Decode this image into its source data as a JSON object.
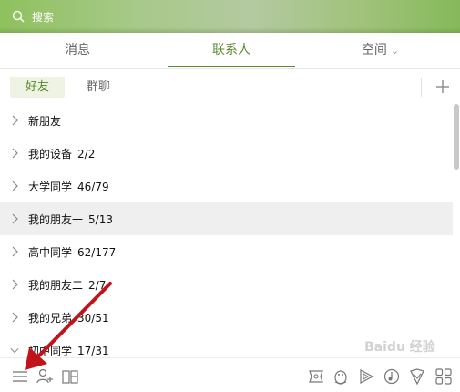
{
  "search": {
    "placeholder": "搜索"
  },
  "tabs": [
    {
      "label": "消息"
    },
    {
      "label": "联系人",
      "active": true
    },
    {
      "label": "空间"
    }
  ],
  "subtabs": [
    {
      "label": "好友",
      "active": true
    },
    {
      "label": "群聊"
    }
  ],
  "groups": [
    {
      "name": "新朋友",
      "count": ""
    },
    {
      "name": "我的设备",
      "count": "2/2"
    },
    {
      "name": "大学同学",
      "count": "46/79"
    },
    {
      "name": "我的朋友一",
      "count": "5/13",
      "hover": true
    },
    {
      "name": "高中同学",
      "count": "62/177"
    },
    {
      "name": "我的朋友二",
      "count": "2/7"
    },
    {
      "name": "我的兄弟",
      "count": "30/51"
    },
    {
      "name": "初中同学",
      "count": "17/31",
      "expanded": true
    }
  ],
  "watermark": "Baidu 经验",
  "colors": {
    "accent": "#5a8a2e",
    "header_green": "#9fc279",
    "annotation_red": "#c0141a"
  },
  "icons": {
    "bottom_left": [
      "menu-icon",
      "add-friend-icon",
      "app-manager-icon"
    ],
    "bottom_right": [
      "game-icon",
      "pet-penguin-icon",
      "video-play-icon",
      "music-icon",
      "security-shield-icon",
      "apps-grid-icon"
    ]
  }
}
